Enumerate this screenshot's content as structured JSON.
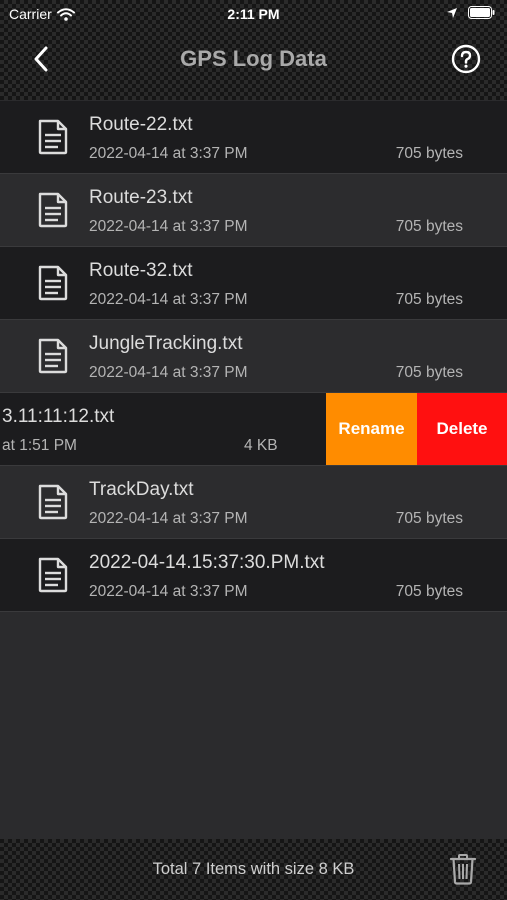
{
  "status_bar": {
    "carrier": "Carrier",
    "time": "2:11 PM"
  },
  "nav": {
    "title": "GPS Log Data",
    "back_icon": "chevron-left-icon",
    "help_icon": "question-circle-icon"
  },
  "files": [
    {
      "name": "Route-22.txt",
      "date": "2022-04-14 at 3:37 PM",
      "size": "705 bytes"
    },
    {
      "name": "Route-23.txt",
      "date": "2022-04-14 at 3:37 PM",
      "size": "705 bytes"
    },
    {
      "name": "Route-32.txt",
      "date": "2022-04-14 at 3:37 PM",
      "size": "705 bytes"
    },
    {
      "name": "JungleTracking.txt",
      "date": "2022-04-14 at 3:37 PM",
      "size": "705 bytes"
    },
    {
      "name": "3.11:11:12.txt",
      "date": "at 1:51 PM",
      "size": "4 KB"
    },
    {
      "name": "TrackDay.txt",
      "date": "2022-04-14 at 3:37 PM",
      "size": "705 bytes"
    },
    {
      "name": "2022-04-14.15:37:30.PM.txt",
      "date": "2022-04-14 at 3:37 PM",
      "size": "705 bytes"
    }
  ],
  "swipe_actions": {
    "rename": "Rename",
    "delete": "Delete"
  },
  "colors": {
    "rename": "#ff8c00",
    "delete": "#ff1010",
    "background": "#2b2b2d"
  },
  "footer": {
    "summary": "Total 7 Items with size 8 KB",
    "trash_icon": "trash-icon"
  }
}
